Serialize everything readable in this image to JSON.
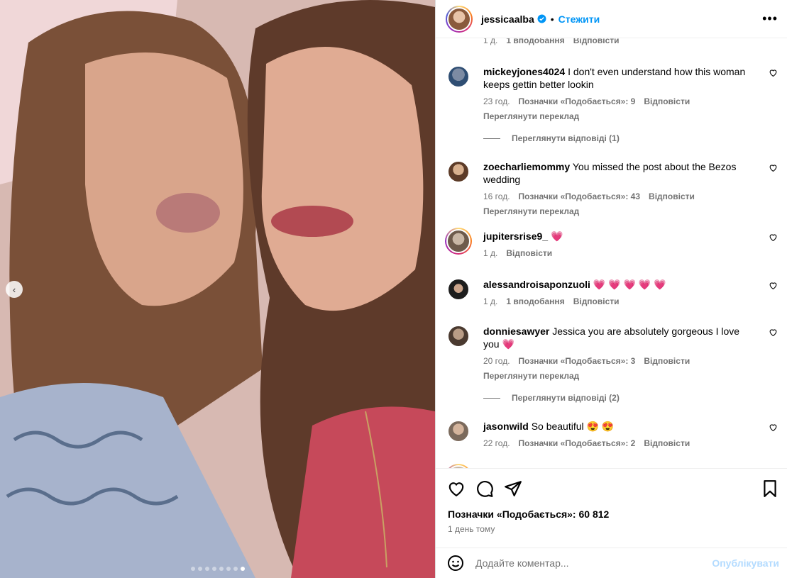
{
  "header": {
    "username": "jessicaalba",
    "separator": "•",
    "follow_label": "Стежити",
    "more_glyph": "•••"
  },
  "carousel": {
    "prev_glyph": "‹",
    "slides_total": 8,
    "active_slide": 8
  },
  "comments": [
    {
      "user": "",
      "text": "",
      "time": "1 д.",
      "likes": "1 вподобання",
      "reply": "Відповісти"
    },
    {
      "user": "mickeyjones4024",
      "text": "I don't even understand how this woman keeps gettin better lookin",
      "time": "23 год.",
      "likes": "Позначки «Подобається»: 9",
      "reply": "Відповісти",
      "translate": "Переглянути переклад",
      "view_replies": "Переглянути відповіді (1)"
    },
    {
      "user": "zoecharliemommy",
      "text": "You missed the post about the Bezos wedding",
      "time": "16 год.",
      "likes": "Позначки «Подобається»: 43",
      "reply": "Відповісти",
      "translate": "Переглянути переклад"
    },
    {
      "user": "jupitersrise9_",
      "text": "💗",
      "time": "1 д.",
      "reply": "Відповісти"
    },
    {
      "user": "alessandroisaponzuoli",
      "text": "💗 💗 💗 💗 💗",
      "time": "1 д.",
      "likes": "1 вподобання",
      "reply": "Відповісти"
    },
    {
      "user": "donniesawyer",
      "text": "Jessica you are absolutely gorgeous I love you 💗",
      "time": "20 год.",
      "likes": "Позначки «Подобається»: 3",
      "reply": "Відповісти",
      "translate": "Переглянути переклад",
      "view_replies": "Переглянути відповіді (2)"
    },
    {
      "user": "jasonwild",
      "text": "So beautiful 😍 😍",
      "time": "22 год.",
      "likes": "Позначки «Подобається»: 2",
      "reply": "Відповісти"
    }
  ],
  "footer": {
    "likes": "Позначки «Подобається»: 60 812",
    "time": "1 день тому",
    "comment_placeholder": "Додайте коментар...",
    "post_label": "Опублікувати"
  },
  "colors": {
    "accent": "#0095f6",
    "muted": "#737373",
    "heart": "#e8336d"
  },
  "icons": [
    "heart-icon",
    "comment-icon",
    "share-icon",
    "bookmark-icon",
    "emoji-icon",
    "verified-icon",
    "more-icon"
  ]
}
